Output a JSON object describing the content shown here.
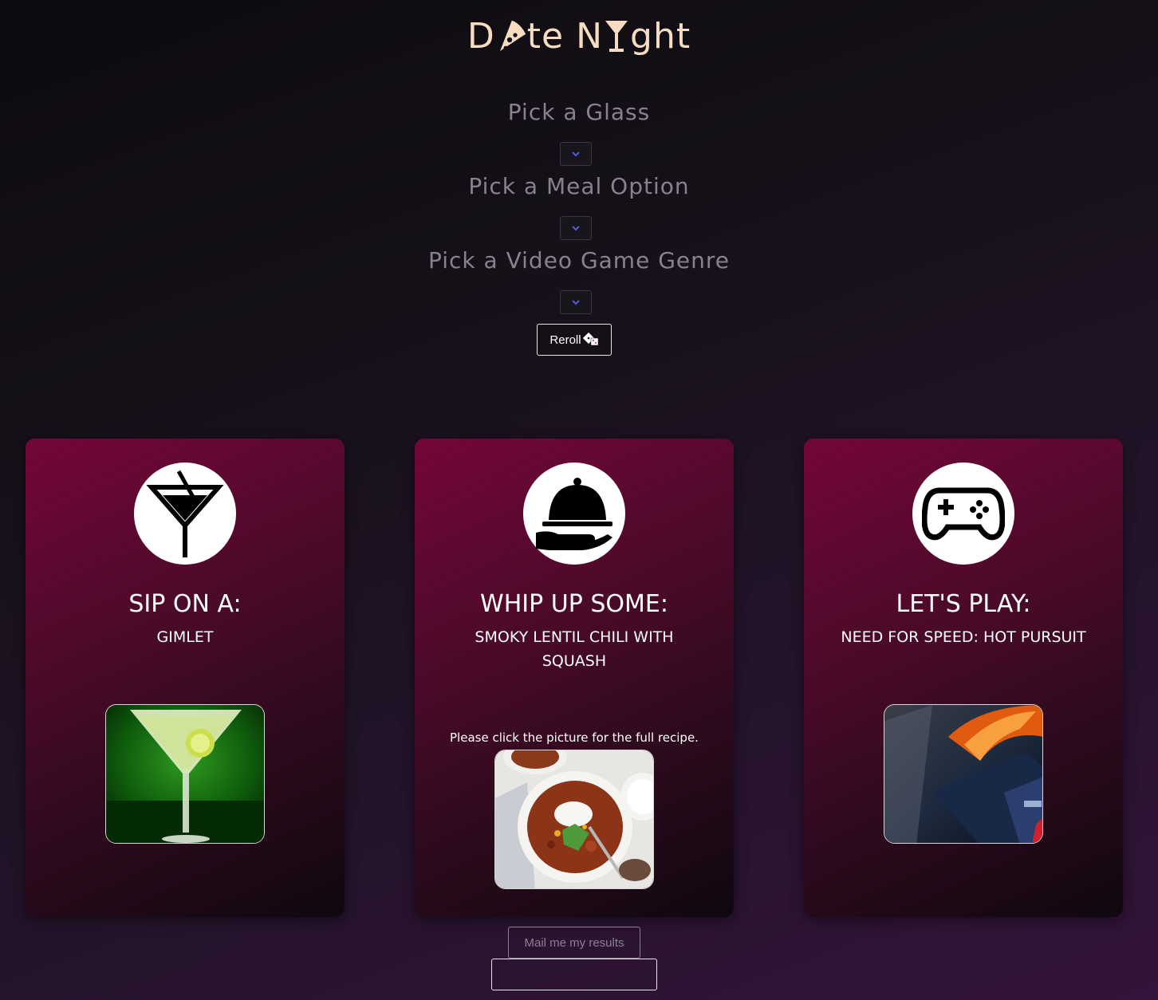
{
  "header": {
    "title_parts": [
      "D",
      "te N",
      "ght"
    ]
  },
  "pickers": [
    {
      "label": "Pick a Glass"
    },
    {
      "label": "Pick a Meal Option"
    },
    {
      "label": "Pick a Video Game Genre"
    }
  ],
  "reroll_label": "Reroll",
  "cards": [
    {
      "heading": "SIP ON A:",
      "subheading": "GIMLET",
      "icon": "martini-glass-icon"
    },
    {
      "heading": "WHIP UP SOME:",
      "subheading": "SMOKY LENTIL CHILI WITH SQUASH",
      "note": "Please click the picture for the full recipe.",
      "icon": "serving-cloche-icon"
    },
    {
      "heading": "LET'S PLAY:",
      "subheading": "NEED FOR SPEED: HOT PURSUIT",
      "icon": "game-controller-icon"
    }
  ],
  "mail_button_label": "Mail me my results",
  "email_input": {
    "value": "",
    "placeholder": ""
  },
  "colors": {
    "title": "#f6dcc0",
    "card_top": "#74063a",
    "picker_text": "#8a8190",
    "chevron": "#4a5fd8"
  }
}
